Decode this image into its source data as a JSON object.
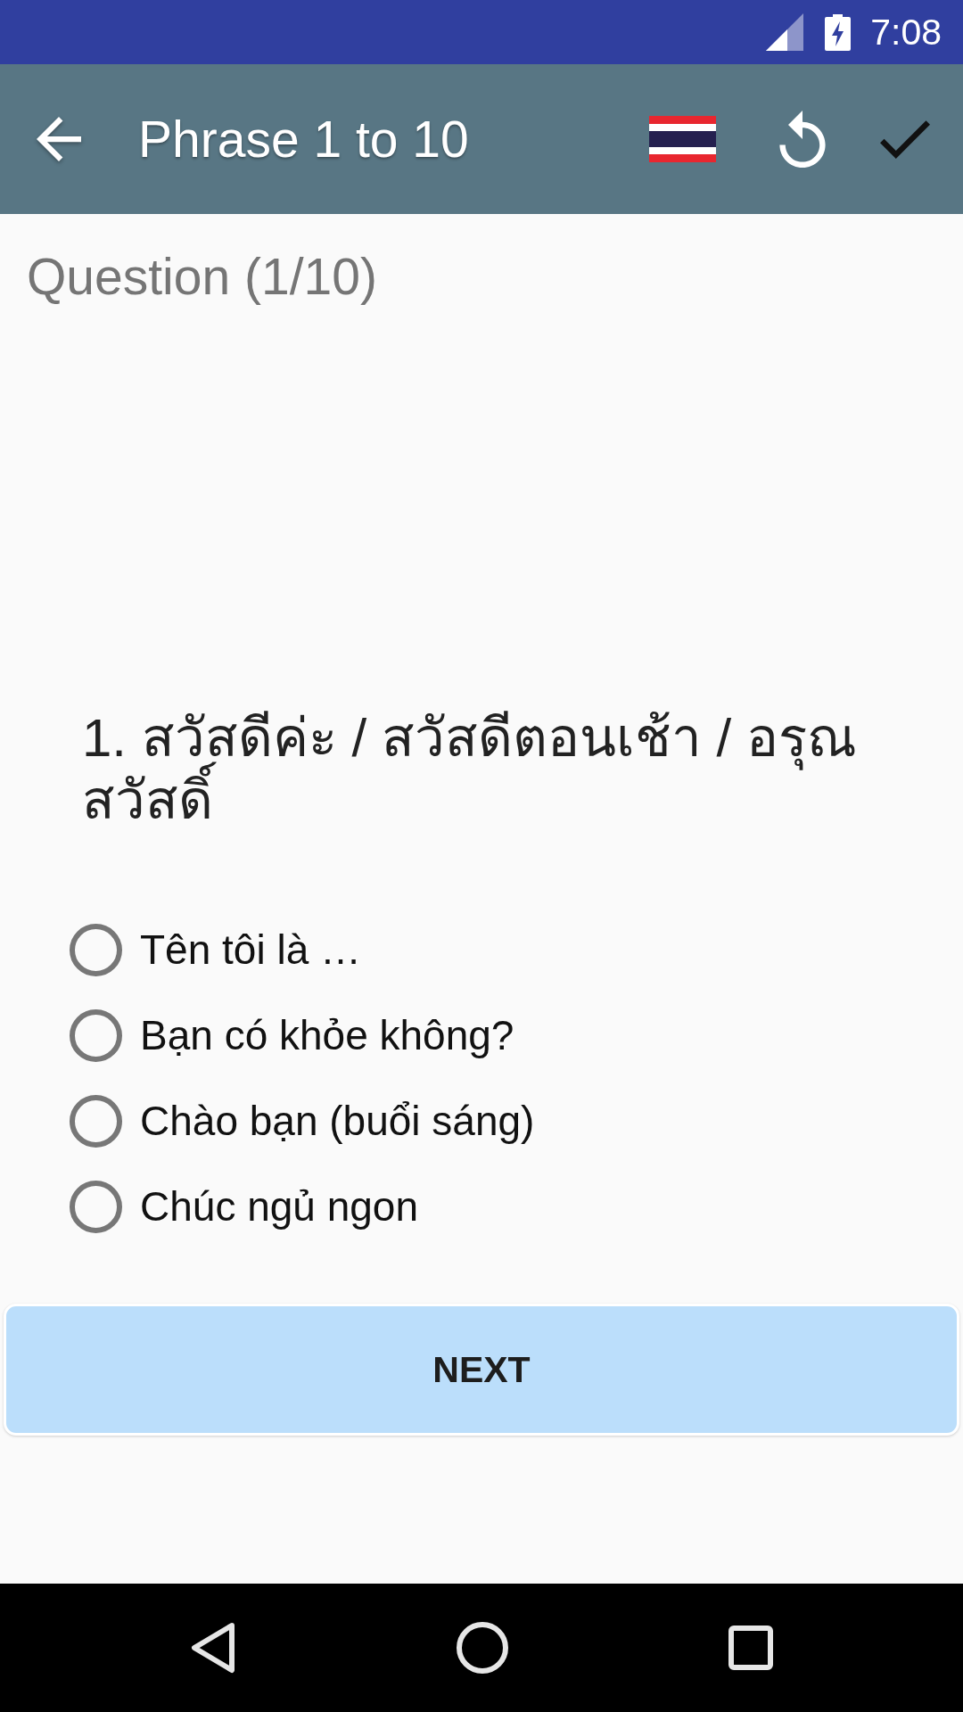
{
  "status_bar": {
    "time": "7:08"
  },
  "toolbar": {
    "title": "Phrase 1 to 10"
  },
  "quiz": {
    "progress": "Question (1/10)",
    "question": "1. สวัสดีค่ะ / สวัสดีตอนเช้า / อรุณสวัสดิ์",
    "options": [
      {
        "label": "Tên tôi là …",
        "selected": false
      },
      {
        "label": "Bạn có khỏe không?",
        "selected": false
      },
      {
        "label": "Chào bạn (buổi sáng)",
        "selected": false
      },
      {
        "label": "Chúc ngủ ngon",
        "selected": false
      }
    ]
  },
  "next_button": {
    "label": "NEXT"
  }
}
